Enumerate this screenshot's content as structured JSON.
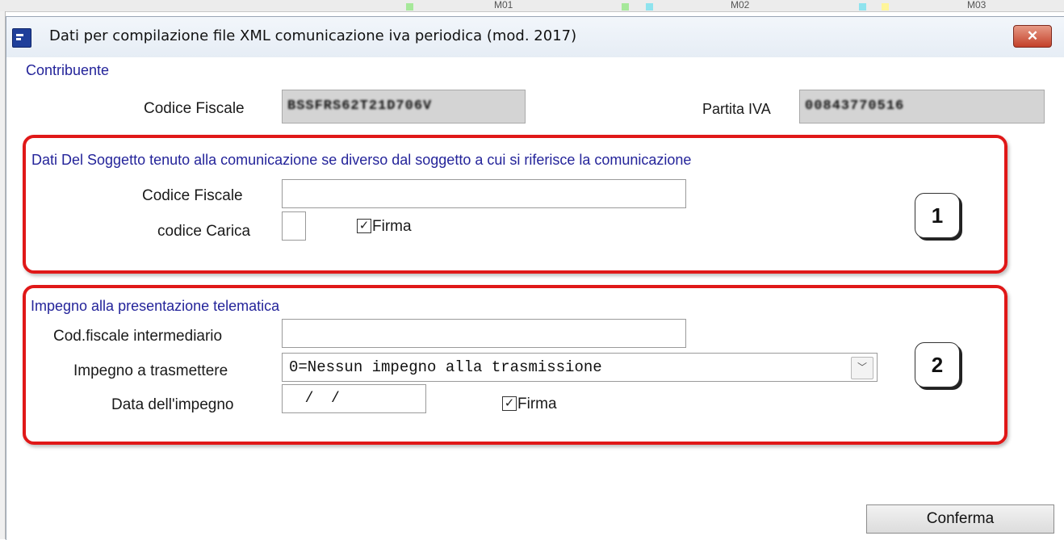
{
  "background": {
    "columns": [
      "M01",
      "M02",
      "M03"
    ],
    "swatches": [
      "#a6e89a",
      "#a6e89a",
      "#8fe3ee",
      "#8fe3ee",
      "#fff59a"
    ]
  },
  "window": {
    "title": "Dati per compilazione file XML comunicazione iva periodica (mod. 2017)",
    "close_label": "✕"
  },
  "contribuente": {
    "heading": "Contribuente",
    "codice_fiscale_label": "Codice Fiscale",
    "codice_fiscale_value": "BSSFRS62T21D706V",
    "partita_iva_label": "Partita IVA",
    "partita_iva_value": "00843770516"
  },
  "soggetto": {
    "heading": "Dati Del Soggetto tenuto alla comunicazione se diverso dal soggetto a cui si riferisce la comunicazione",
    "codice_fiscale_label": "Codice Fiscale",
    "codice_fiscale_value": "",
    "codice_carica_label": "codice Carica",
    "codice_carica_value": "",
    "firma_label": "Firma",
    "firma_checked": true,
    "badge": "1"
  },
  "impegno": {
    "heading": "Impegno alla presentazione telematica",
    "cod_fiscale_intermediario_label": "Cod.fiscale intermediario",
    "cod_fiscale_intermediario_value": "",
    "impegno_trasmettere_label": "Impegno a trasmettere",
    "impegno_trasmettere_value": "0=Nessun impegno alla trasmissione",
    "data_impegno_label": "Data dell'impegno",
    "data_impegno_value": "  /  /",
    "firma_label": "Firma",
    "firma_checked": true,
    "badge": "2"
  },
  "actions": {
    "conferma_label": "Conferma"
  },
  "colors": {
    "accent_red": "#e01818",
    "heading_blue": "#24249a"
  }
}
